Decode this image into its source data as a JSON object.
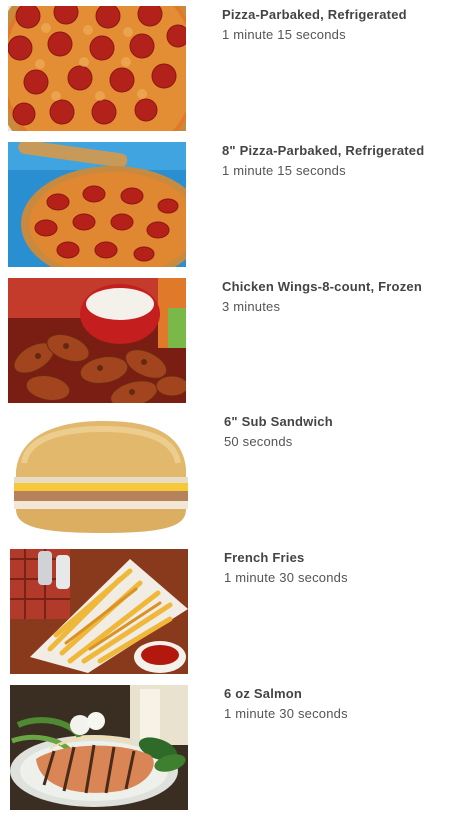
{
  "items": [
    {
      "name": "Pizza-Parbaked, Refrigerated",
      "time": "1 minute 15 seconds",
      "icon": "pizza-image"
    },
    {
      "name": "8\" Pizza-Parbaked, Refrigerated",
      "time": "1 minute 15 seconds",
      "icon": "pizza-image"
    },
    {
      "name": "Chicken Wings-8-count, Frozen",
      "time": "3 minutes",
      "icon": "chicken-wings-image"
    },
    {
      "name": "6\" Sub Sandwich",
      "time": "50 seconds",
      "icon": "sub-sandwich-image"
    },
    {
      "name": "French Fries",
      "time": "1 minute 30 seconds",
      "icon": "french-fries-image"
    },
    {
      "name": "6 oz Salmon",
      "time": "1 minute 30 seconds",
      "icon": "salmon-image"
    }
  ]
}
